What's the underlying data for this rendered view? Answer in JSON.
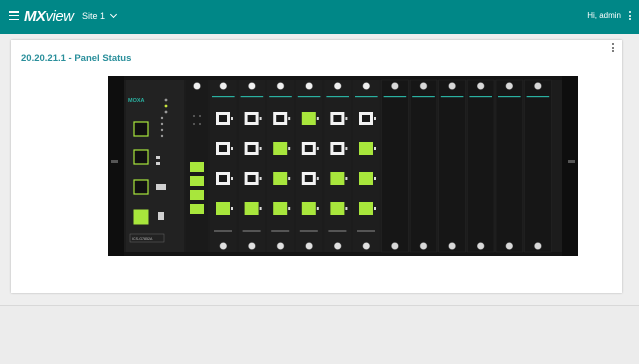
{
  "header": {
    "brand_mx": "MX",
    "brand_view": "view",
    "site_label": "Site 1",
    "user_label": "Hi, admin",
    "menu_icon": "hamburger-menu-icon",
    "site_dropdown_icon": "chevron-down-icon",
    "user_menu_icon": "kebab-menu-icon"
  },
  "panel": {
    "title": "20.20.21.1 - Panel Status",
    "menu_icon": "kebab-menu-icon"
  },
  "device": {
    "brand": "MOXA",
    "model": "ICS-G7852A"
  },
  "colors": {
    "header": "#008787",
    "title": "#2a8f9b",
    "port_active": "#a8e63c",
    "port_idle": "#1a1a1a",
    "accent_line": "#2ab0a0"
  },
  "modules": [
    {
      "name": "module-1",
      "ports": [
        0,
        0,
        0,
        1
      ]
    },
    {
      "name": "module-2",
      "ports": [
        0,
        0,
        0,
        1
      ]
    },
    {
      "name": "module-3",
      "ports": [
        0,
        1,
        1,
        1
      ]
    },
    {
      "name": "module-4",
      "ports": [
        1,
        0,
        0,
        1
      ]
    },
    {
      "name": "module-5",
      "ports": [
        0,
        0,
        1,
        1
      ]
    },
    {
      "name": "module-6",
      "ports": [
        0,
        1,
        1,
        1
      ]
    }
  ]
}
